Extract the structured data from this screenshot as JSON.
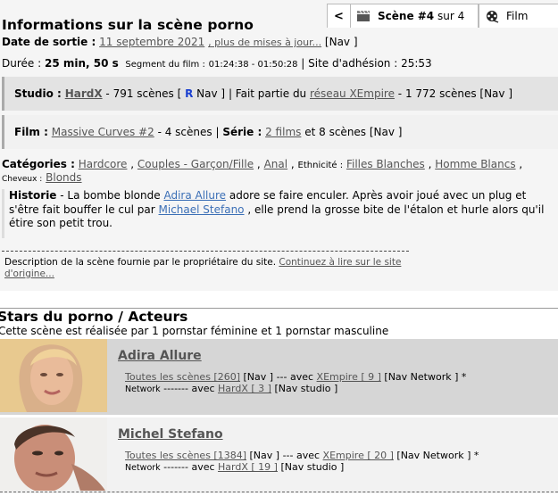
{
  "info": {
    "title": "Informations sur la scène porno",
    "release_label": "Date de sortie :",
    "release_date": "11 septembre 2021",
    "more_updates": ", plus de mises à jour...",
    "nav": "[Nav ]",
    "duration_label": "Durée :",
    "duration": "25 min, 50 s",
    "segment_label": "Segment du film :",
    "segment": "01:24:38 - 01:50:28",
    "site_label": "| Site d'adhésion : 25:53"
  },
  "nav_tabs": {
    "prev": "<",
    "scene_label": "Scène #4",
    "scene_of": "sur 4",
    "film_label": "Film"
  },
  "studio": {
    "label": "Studio :",
    "name": "HardX",
    "count": "- 791 scènes [",
    "r": "R",
    "nav": "Nav ]",
    "part_of": "| Fait partie du",
    "network": "réseau XEmpire",
    "network_count": "- 1 772 scènes [Nav ]"
  },
  "film": {
    "label": "Film :",
    "name": "Massive Curves #2",
    "count": "- 4 scènes |",
    "series_label": "Série :",
    "series": "2 films",
    "series_count": "et 8 scènes [Nav ]"
  },
  "categories": {
    "label": "Catégories :",
    "items": [
      "Hardcore",
      "Couples - Garçon/Fille",
      "Anal"
    ],
    "ethnicity_label": "Ethnicité :",
    "ethnicity": [
      "Filles Blanches",
      "Homme Blancs"
    ],
    "hair_label": "Cheveux :",
    "hair": "Blonds"
  },
  "history": {
    "label": "Historie",
    "part1": " - La bombe blonde ",
    "actor1": "Adira Allure",
    "part2": " adore se faire enculer. Après avoir joué avec un plug et s'être fait bouffer le cul par ",
    "actor2": "Michael Stefano",
    "part3": " , elle prend la grosse bite de l'étalon et hurle alors qu'il étire son petit trou."
  },
  "description_note": {
    "text": "Description de la scène fournie par le propriétaire du site. ",
    "link": "Continuez à lire sur le site d'origine..."
  },
  "stars": {
    "title": "Stars du porno / Acteurs",
    "summary": "Cette scène est réalisée par 1 pornstar féminine et 1 pornstar masculine",
    "list": [
      {
        "name": "Adira Allure",
        "all_scenes": "Toutes les scènes [260]",
        "nav": "[Nav ] --- avec",
        "network_link": "XEmpire [ 9 ]",
        "network_nav": "[Nav Network ] *",
        "network_word": "Network",
        "avec_studio": "------- avec",
        "studio_link": "HardX [ 3 ]",
        "studio_nav": "[Nav studio ]"
      },
      {
        "name": "Michel Stefano",
        "all_scenes": "Toutes les scènes [1384]",
        "nav": "[Nav ] --- avec",
        "network_link": "XEmpire [ 20 ]",
        "network_nav": "[Nav Network ] *",
        "network_word": "Network",
        "avec_studio": "------- avec",
        "studio_link": "HardX [ 19 ]",
        "studio_nav": "[Nav studio ]"
      }
    ]
  },
  "icons": {
    "clapper": "clapperboard-icon",
    "film_reel": "film-reel-icon"
  }
}
